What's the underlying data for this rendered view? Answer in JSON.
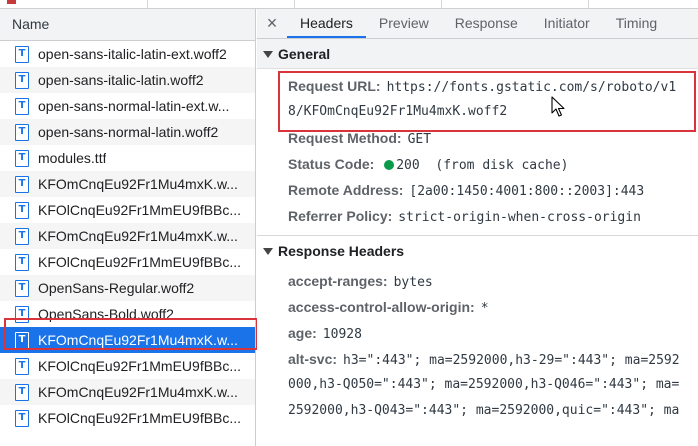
{
  "list": {
    "header": "Name",
    "rows": [
      {
        "icon": "font-file-icon",
        "name": "open-sans-italic-latin-ext.woff2",
        "selected": false
      },
      {
        "icon": "font-file-icon",
        "name": "open-sans-italic-latin.woff2",
        "selected": false
      },
      {
        "icon": "font-file-icon",
        "name": "open-sans-normal-latin-ext.w...",
        "selected": false
      },
      {
        "icon": "font-file-icon",
        "name": "open-sans-normal-latin.woff2",
        "selected": false
      },
      {
        "icon": "font-file-icon",
        "name": "modules.ttf",
        "selected": false
      },
      {
        "icon": "font-file-icon",
        "name": "KFOmCnqEu92Fr1Mu4mxK.w...",
        "selected": false
      },
      {
        "icon": "font-file-icon",
        "name": "KFOlCnqEu92Fr1MmEU9fBBc...",
        "selected": false
      },
      {
        "icon": "font-file-icon",
        "name": "KFOmCnqEu92Fr1Mu4mxK.w...",
        "selected": false
      },
      {
        "icon": "font-file-icon",
        "name": "KFOlCnqEu92Fr1MmEU9fBBc...",
        "selected": false
      },
      {
        "icon": "font-file-icon",
        "name": "OpenSans-Regular.woff2",
        "selected": false
      },
      {
        "icon": "font-file-icon",
        "name": "OpenSans-Bold.woff2",
        "selected": false
      },
      {
        "icon": "font-file-icon",
        "name": "KFOmCnqEu92Fr1Mu4mxK.w...",
        "selected": true
      },
      {
        "icon": "font-file-icon",
        "name": "KFOlCnqEu92Fr1MmEU9fBBc...",
        "selected": false
      },
      {
        "icon": "font-file-icon",
        "name": "KFOmCnqEu92Fr1Mu4mxK.w...",
        "selected": false
      },
      {
        "icon": "font-file-icon",
        "name": "KFOlCnqEu92Fr1MmEU9fBBc...",
        "selected": false
      }
    ]
  },
  "tabs": {
    "close": "×",
    "items": [
      "Headers",
      "Preview",
      "Response",
      "Initiator",
      "Timing"
    ],
    "active": "Headers"
  },
  "general": {
    "title": "General",
    "request_url_label": "Request URL:",
    "request_url_line1": "https://fonts.gstatic.com/s/roboto/v1",
    "request_url_line2": "8/KFOmCnqEu92Fr1Mu4mxK.woff2",
    "request_method_label": "Request Method:",
    "request_method_value": "GET",
    "status_code_label": "Status Code:",
    "status_code_value": "200",
    "status_code_note": "(from disk cache)",
    "status_color": "#0a9a4a",
    "remote_address_label": "Remote Address:",
    "remote_address_value": "[2a00:1450:4001:800::2003]:443",
    "referrer_policy_label": "Referrer Policy:",
    "referrer_policy_value": "strict-origin-when-cross-origin"
  },
  "response_headers": {
    "title": "Response Headers",
    "accept_ranges_label": "accept-ranges:",
    "accept_ranges_value": "bytes",
    "acao_label": "access-control-allow-origin:",
    "acao_value": "*",
    "age_label": "age:",
    "age_value": "10928",
    "alt_svc_label": "alt-svc:",
    "alt_svc_line1": "h3=\":443\"; ma=2592000,h3-29=\":443\"; ma=2592",
    "alt_svc_line2": "000,h3-Q050=\":443\"; ma=2592000,h3-Q046=\":443\"; ma=",
    "alt_svc_line3": "2592000,h3-Q043=\":443\"; ma=2592000,quic=\":443\"; ma"
  },
  "colors": {
    "highlight_box": "#d9343c",
    "selection": "#1a73e8",
    "tab_underline": "#1a73e8"
  }
}
